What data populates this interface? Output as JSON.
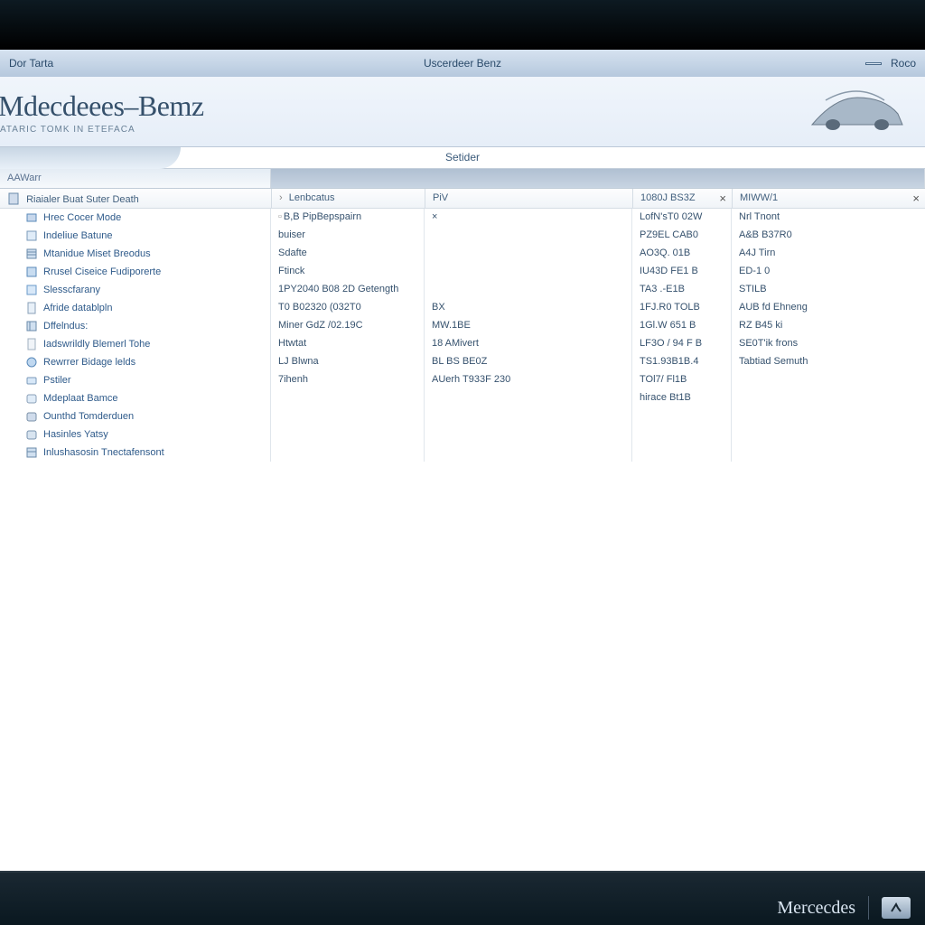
{
  "titlebar": {
    "left": "Dor Tarta",
    "center": "Uscerdeer Benz",
    "right": "Roco"
  },
  "header": {
    "brand": "Mdecdeees–Bemz",
    "subtitle": "ATARIC TOMK IN ETEFACA"
  },
  "subheader": {
    "center": "Setider"
  },
  "columns_header": {
    "c1": "AAWarr"
  },
  "filter_row": {
    "c1": "Riaialer Buat Suter Death",
    "c2": "Lenbcatus",
    "c3": "PiV",
    "c4": "1080J BS3Z",
    "c5": "MIWW/1"
  },
  "nav_items": [
    "Hrec Cocer Mode",
    "Indeliue Batune",
    "Mtanidue Miset Breodus",
    "Rrusel Ciseice Fudiporerte",
    "Slesscfarany",
    "Afride datablpln",
    "Dffelndus:",
    "Iadswrildly Blemerl Tohe",
    "Rewrrer Bidage lelds",
    "Pstiler",
    "Mdeplaat Bamce",
    "Ounthd Tomderduen",
    "Hasinles Yatsy",
    "Inlushasosin Tnectafensont"
  ],
  "col2_rows": [
    "B,B PipBepspairn",
    "buiser",
    "Sdafte",
    "Ftinck",
    "1PY2040 B08 2D Getength",
    "T0 B02320 (032T0",
    "Miner GdZ /02.19C",
    "Htwtat",
    "LJ Blwna",
    "7ihenh"
  ],
  "col3_rows": [
    "×",
    "",
    "",
    "",
    "",
    "BX",
    "MW.1BE",
    "18 AMivert",
    "BL       BS BE0Z",
    "AUerh T933F 230"
  ],
  "col4_rows": [
    "LofN'sT0 02W",
    "PZ9EL CAB0",
    "AO3Q.  01B",
    "IU43D FE1 B",
    "TA3 .-E1B",
    "1FJ.R0 TOLB",
    "1Gl.W  651 B",
    "LF3O / 94 F B",
    "TS1.93B1B.4",
    "TOl7/ Fl1B",
    "hirace Bt1B"
  ],
  "col5_rows": [
    "Nrl Tnont",
    "A&B B37R0",
    "A4J Tirn",
    "ED-1 0",
    "STILB",
    "AUB fd Ehneng",
    "RZ B45 ki",
    "SE0T'ik frons",
    "Tabtiad Semuth"
  ],
  "footer": {
    "brand": "Mercecdes"
  }
}
